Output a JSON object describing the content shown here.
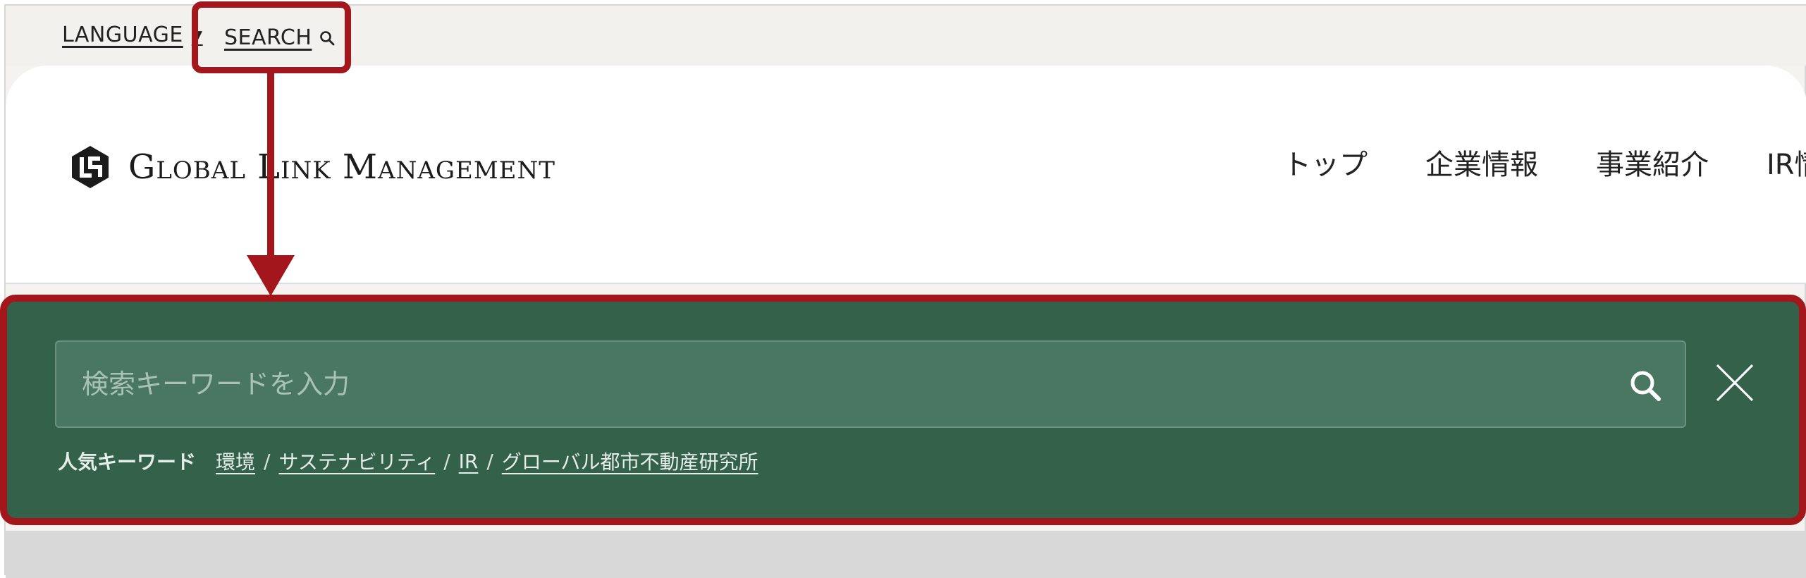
{
  "utility_bar": {
    "language_label": "LANGUAGE",
    "search_label": "SEARCH",
    "caret_icon": "caret-down-icon",
    "search_icon": "search-icon"
  },
  "header": {
    "logo_text": "Global Link Management",
    "logo_icon": "glm-logo-mark",
    "nav": [
      "トップ",
      "企業情報",
      "事業紹介",
      "IR情"
    ]
  },
  "search_panel": {
    "placeholder": "検索キーワードを入力",
    "value": "",
    "submit_icon": "search-icon",
    "close_icon": "close-icon",
    "keywords_title": "人気キーワード",
    "keywords": [
      "環境",
      "サステナビリティ",
      "IR",
      "グローバル都市不動産研究所"
    ],
    "separator": "/"
  },
  "colors": {
    "panel_bg": "#33614a",
    "input_bg": "#4a7762",
    "annotation_red": "#a3171c",
    "utility_bg": "#f3f1ed"
  }
}
